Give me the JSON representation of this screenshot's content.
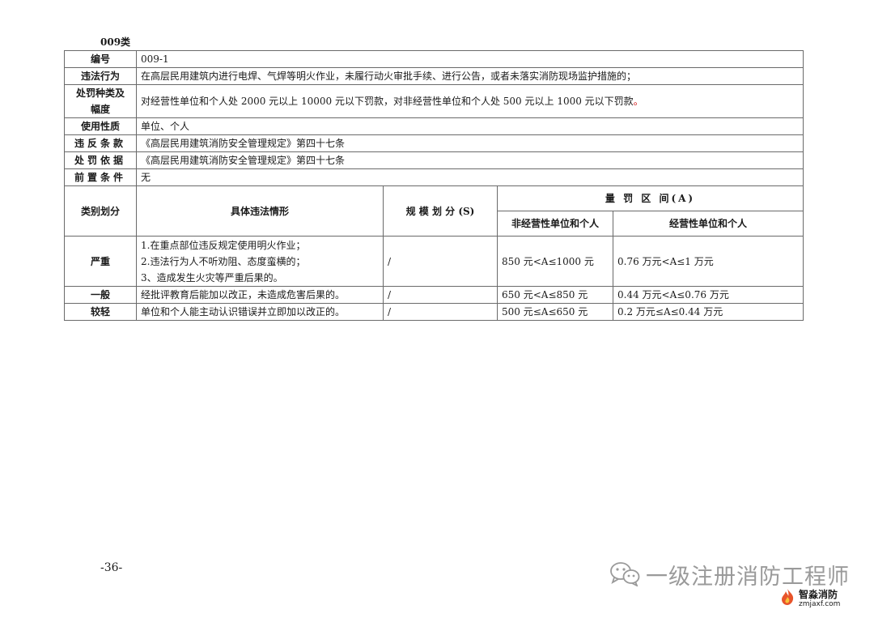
{
  "category_title": "009类",
  "rows": {
    "code": {
      "label": "编号",
      "value": "009-1"
    },
    "violation": {
      "label": "违法行为",
      "value": "在高层民用建筑内进行电焊、气焊等明火作业，未履行动火审批手续、进行公告，或者未落实消防现场监护措施的；"
    },
    "penalty": {
      "label_line1": "处罚种类及",
      "label_line2": "幅度",
      "value": "对经营性单位和个人处 2000 元以上 10000 元以下罚款，对非经营性单位和个人处 500 元以上 1000 元以下罚款",
      "value_end": "。"
    },
    "nature": {
      "label": "使用性质",
      "value": "单位、个人"
    },
    "clause": {
      "label": "违反条款",
      "value": "《高层民用建筑消防安全管理规定》第四十七条"
    },
    "basis": {
      "label": "处罚依据",
      "value": "《高层民用建筑消防安全管理规定》第四十七条"
    },
    "precondition": {
      "label": "前置条件",
      "value": "无"
    }
  },
  "grid_header": {
    "category": "类别划分",
    "situation": "具体违法情形",
    "scale": "规 模 划 分 (S)",
    "range": "量 罚 区 间(A)",
    "non_commercial": "非经营性单位和个人",
    "commercial": "经营性单位和个人"
  },
  "levels": [
    {
      "name": "严重",
      "situations": [
        "1.在重点部位违反规定使用明火作业；",
        "2.违法行为人不听劝阻、态度蛮横的；",
        "3、造成发生火灾等严重后果的。"
      ],
      "scale": "/",
      "non_commercial": "850 元<A≤1000 元",
      "commercial": "0.76 万元<A≤1 万元"
    },
    {
      "name": "一般",
      "situations": [
        "经批评教育后能加以改正，未造成危害后果的。"
      ],
      "scale": "/",
      "non_commercial": "650 元<A≤850 元",
      "commercial": "0.44 万元<A≤0.76 万元"
    },
    {
      "name": "较轻",
      "situations": [
        "单位和个人能主动认识错误并立即加以改正的。"
      ],
      "scale": "/",
      "non_commercial": "500 元≤A≤650 元",
      "commercial": "0.2 万元≤A≤0.44 万元"
    }
  ],
  "page_number": "-36-",
  "watermark": {
    "text": "一级注册消防工程师",
    "icon": "wechat-icon"
  },
  "brand": {
    "name": "智淼消防",
    "url": "zmjaxf.com",
    "icon": "fire-logo-icon"
  },
  "colors": {
    "accent_red": "#cc0000",
    "watermark_gray": "#9a9a9a",
    "border": "#6a6a6a"
  }
}
